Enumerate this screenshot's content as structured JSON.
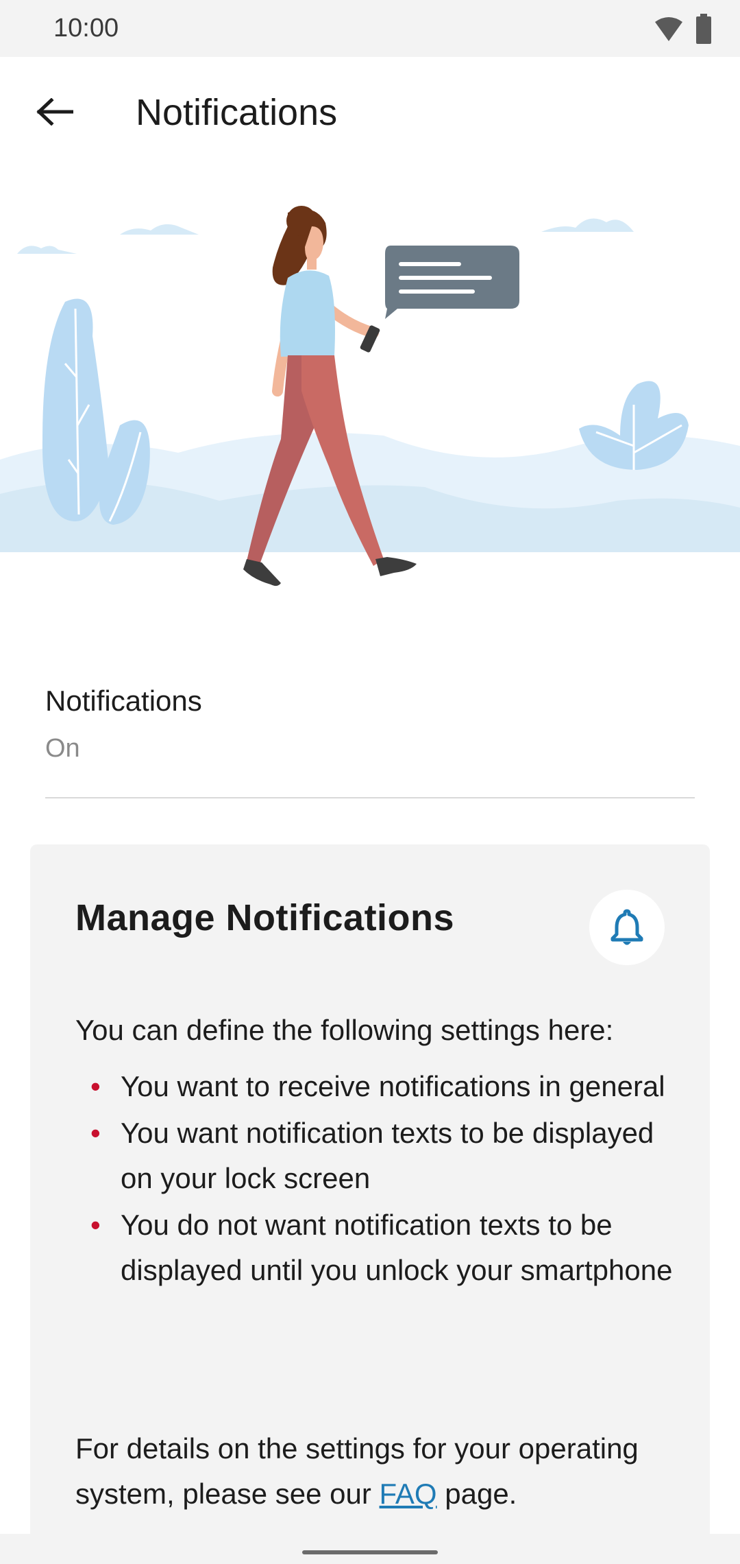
{
  "status_bar": {
    "time": "10:00",
    "icons": [
      "wifi-icon",
      "battery-icon"
    ]
  },
  "app_bar": {
    "title": "Notifications",
    "back_icon": "arrow-left-icon"
  },
  "setting": {
    "title": "Notifications",
    "value": "On"
  },
  "card": {
    "title": "Manage Notifications",
    "icon": "bell-icon",
    "intro": "You can define the following settings here:",
    "bullets": [
      "You want to receive notifications in general",
      "You want notification texts to be displayed on your lock screen",
      "You do not want notification texts to be displayed until you unlock your smartphone"
    ],
    "footer_before": "For details on the settings for your operating system, please see our ",
    "footer_link": "FAQ",
    "footer_after": " page."
  },
  "colors": {
    "accent": "#1f7bb5",
    "bullet": "#c8102e",
    "card_bg": "#f3f3f3"
  }
}
